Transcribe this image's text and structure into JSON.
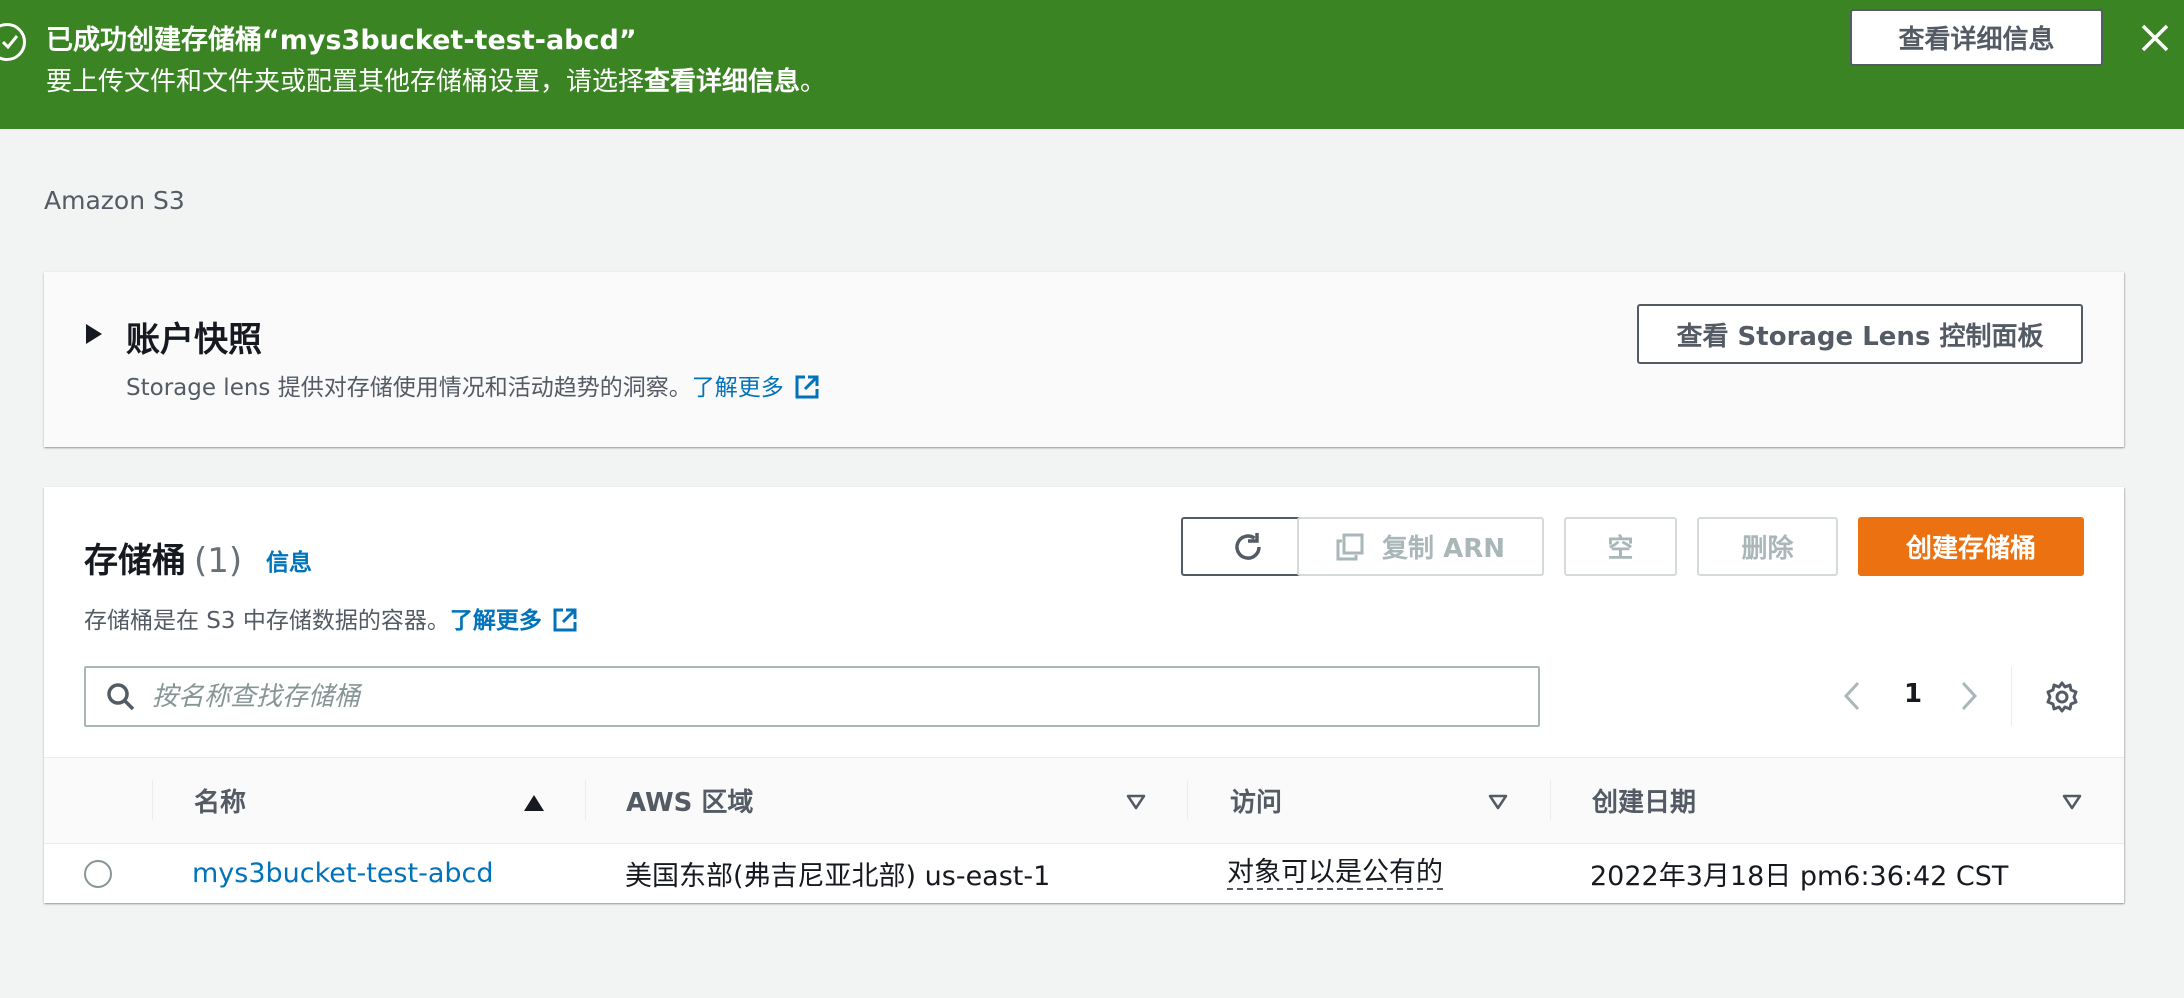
{
  "flash": {
    "title": "已成功创建存储桶“mys3bucket-test-abcd”",
    "description_prefix": "要上传文件和文件夹或配置其他存储桶设置，请选择",
    "description_bold": "查看详细信息",
    "description_suffix": "。",
    "button_label": "查看详细信息",
    "icons": {
      "status": "success-check-icon",
      "close": "close-icon"
    }
  },
  "breadcrumb": {
    "label": "Amazon S3"
  },
  "snapshot": {
    "title": "账户快照",
    "description": "Storage lens 提供对存储使用情况和活动趋势的洞察。",
    "learn_more": "了解更多",
    "button_label": "查看 Storage Lens 控制面板"
  },
  "buckets": {
    "title": "存储桶",
    "count": "(1)",
    "info_link": "信息",
    "description": "存储桶是在 S3 中存储数据的容器。",
    "learn_more": "了解更多",
    "actions": {
      "copy_arn": "复制 ARN",
      "empty": "空",
      "delete": "删除",
      "create": "创建存储桶"
    },
    "search": {
      "placeholder": "按名称查找存储桶",
      "value": ""
    },
    "pagination": {
      "current_page": "1"
    },
    "columns": [
      "名称",
      "AWS 区域",
      "访问",
      "创建日期"
    ],
    "rows": [
      {
        "name": "mys3bucket-test-abcd",
        "region": "美国东部(弗吉尼亚北部) us-east-1",
        "access": "对象可以是公有的",
        "created": "2022年3月18日 pm6:36:42 CST"
      }
    ]
  },
  "colors": {
    "success_green": "#3b8424",
    "primary_orange": "#ec7211",
    "link_blue": "#0073bb",
    "page_background": "#f2f3f3"
  }
}
